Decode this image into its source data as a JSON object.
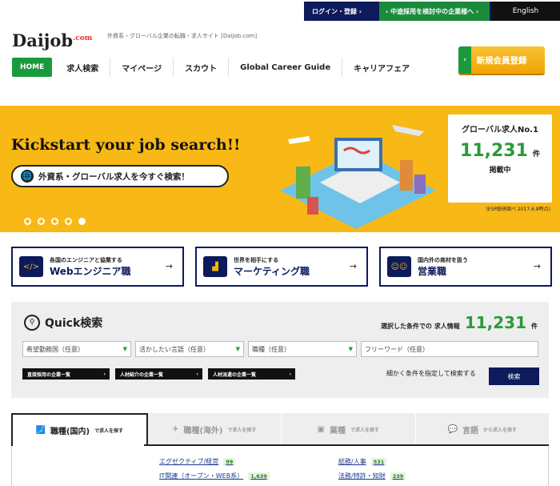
{
  "topbar": {
    "login": "ログイン・登録 ›",
    "corp": "› 中途採用を検討中の企業様へ ›",
    "english": "English"
  },
  "header": {
    "logo_main": "Daijob",
    "logo_com": ".com",
    "tagline": "外資系・グローバル企業の転職・求人サイト [Daijob.com]"
  },
  "nav": {
    "home": "HOME",
    "items": [
      "求人検索",
      "マイページ",
      "スカウト",
      "Global Career Guide",
      "キャリアフェア"
    ]
  },
  "signup": {
    "label": "新規会員登録",
    "arrow": "›"
  },
  "hero": {
    "headline": "Kickstart your job search!!",
    "cta": "外資系・グローバル求人を今すぐ検索！",
    "stat_title": "グローバル求人No.1",
    "stat_number": "11,231",
    "stat_unit": "件",
    "stat_posted": "掲載中",
    "stat_note": "(ESP総研調べ 2017.6.8時点)",
    "slide_count": 5,
    "active_slide": 5
  },
  "categories": [
    {
      "sub": "各国のエンジニアと協業する",
      "title": "Webエンジニア職",
      "icon": "code-icon",
      "arrow": "→"
    },
    {
      "sub": "世界を相手にする",
      "title": "マーケティング職",
      "icon": "chart-icon",
      "arrow": "→"
    },
    {
      "sub": "国内外の商材を扱う",
      "title": "営業職",
      "icon": "people-icon",
      "arrow": "→"
    }
  ],
  "quick": {
    "title": "Quick検索",
    "count_label": "選択した条件での 求人情報",
    "count": "11,231",
    "count_unit": "件",
    "selects": [
      "希望勤務国（任意）",
      "活かしたい言語（任意）",
      "職種（任意）"
    ],
    "keyword_placeholder": "フリーワード（任意）",
    "chips": [
      "直接採用の企業一覧",
      "人材紹介の企業一覧",
      "人材派遣の企業一覧"
    ],
    "refine": "細かく条件を指定して検索する",
    "search": "検索"
  },
  "tabs": [
    {
      "label": "職種(国内)",
      "sub": "で求人を探す",
      "icon": "japan-map-icon"
    },
    {
      "label": "職種(海外)",
      "sub": "で求人を探す",
      "icon": "airplane-icon"
    },
    {
      "label": "業種",
      "sub": "で求人を探す",
      "icon": "briefcase-icon"
    },
    {
      "label": "言語",
      "sub": "から求人を探す",
      "icon": "speech-icon"
    }
  ],
  "jobs": [
    {
      "label": "エグゼクティブ/経営",
      "count": "99"
    },
    {
      "label": "IT関連（オープン・WEB系）",
      "count": "1,639"
    },
    {
      "label": "総務/人事",
      "count": "531"
    },
    {
      "label": "法務/特許・知財",
      "count": "239"
    }
  ],
  "colors": {
    "navy": "#0d1a5c",
    "green": "#1a9a3a",
    "yellow": "#f8b815"
  }
}
